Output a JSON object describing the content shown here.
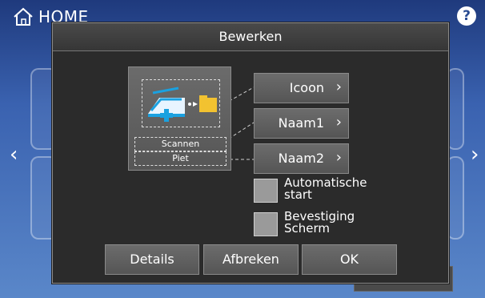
{
  "top_bar": {
    "home_label": "HOME",
    "help_label": "?"
  },
  "dialog": {
    "title": "Bewerken",
    "preview": {
      "scan_name": "Scannen",
      "owner_name": "Piet"
    },
    "options": [
      {
        "label": "Icoon"
      },
      {
        "label": "Naam1"
      },
      {
        "label": "Naam2"
      }
    ],
    "checkboxes": [
      {
        "line1": "Automatische",
        "line2": "start",
        "checked": false
      },
      {
        "line1": "Bevestiging",
        "line2": "Scherm",
        "checked": false
      }
    ],
    "footer": {
      "details": "Details",
      "cancel": "Afbreken",
      "ok": "OK"
    }
  },
  "icons": [
    "home-icon",
    "help-icon",
    "chevron-left-icon",
    "chevron-right-icon",
    "scanner-icon",
    "folder-icon"
  ],
  "colors": {
    "accent_background": "#3a62b0",
    "dialog_background": "#2b2b2b",
    "scanner_blue": "#1aa1e0",
    "folder_yellow": "#f2c230"
  }
}
